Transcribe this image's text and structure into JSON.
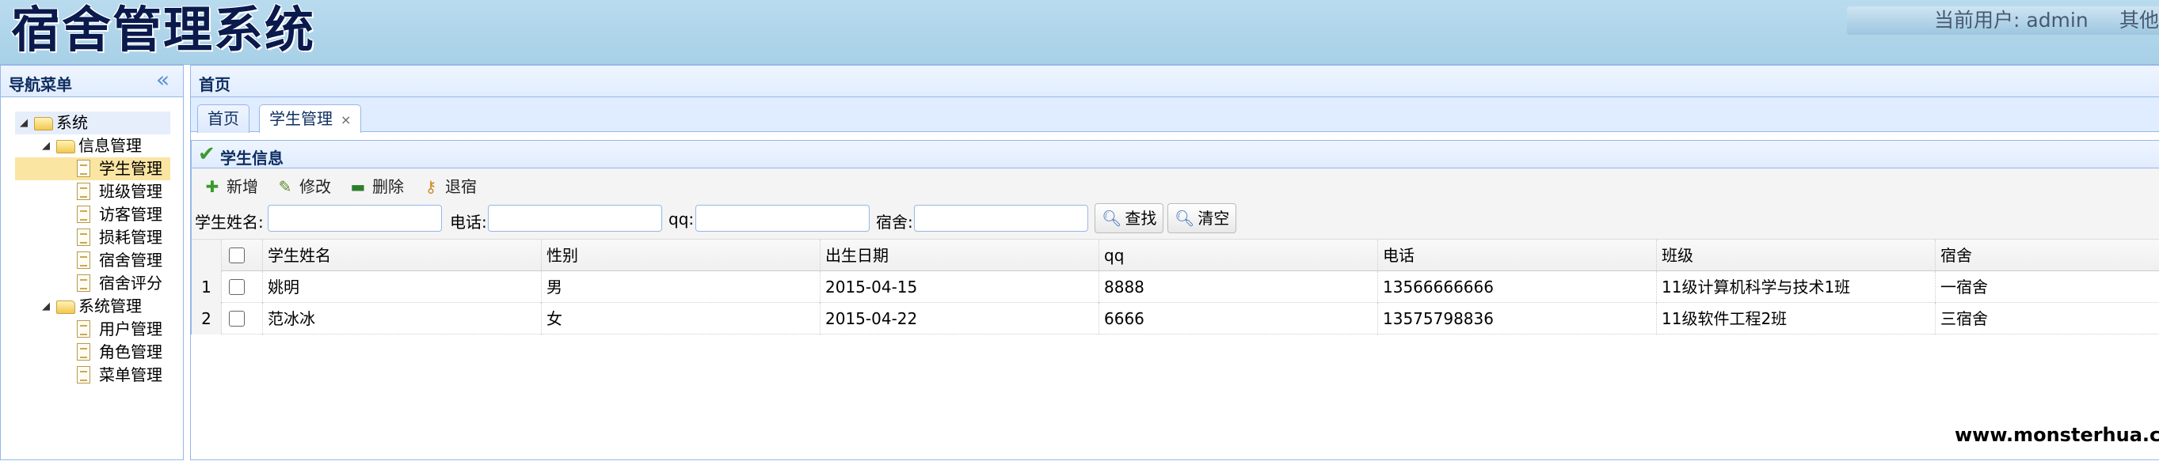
{
  "header": {
    "app_title": "宿舍管理系统",
    "current_user_label": "当前用户: admin",
    "other_label": "其他"
  },
  "nav": {
    "title": "导航菜单",
    "tree": [
      {
        "label": "系统"
      },
      {
        "label": "信息管理"
      },
      {
        "label": "学生管理"
      },
      {
        "label": "班级管理"
      },
      {
        "label": "访客管理"
      },
      {
        "label": "损耗管理"
      },
      {
        "label": "宿舍管理"
      },
      {
        "label": "宿舍评分"
      },
      {
        "label": "系统管理"
      },
      {
        "label": "用户管理"
      },
      {
        "label": "角色管理"
      },
      {
        "label": "菜单管理"
      }
    ]
  },
  "main": {
    "title": "首页",
    "tabs": [
      {
        "label": "首页"
      },
      {
        "label": "学生管理",
        "close": "×"
      }
    ],
    "panel_title": "学生信息",
    "toolbar": {
      "add": "新增",
      "edit": "修改",
      "delete": "删除",
      "checkout": "退宿"
    },
    "search": {
      "name_label": "学生姓名:",
      "name_value": "",
      "phone_label": "电话:",
      "phone_value": "",
      "qq_label": "qq:",
      "qq_value": "",
      "dorm_label": "宿舍:",
      "dorm_value": "",
      "search_button": "查找",
      "clear_button": "清空"
    },
    "grid": {
      "columns": [
        "学生姓名",
        "性别",
        "出生日期",
        "qq",
        "电话",
        "班级",
        "宿舍"
      ],
      "rows": [
        {
          "num": "1",
          "cells": [
            "姚明",
            "男",
            "2015-04-15",
            "8888",
            "13566666666",
            "11级计算机科学与技术1班",
            "一宿舍"
          ]
        },
        {
          "num": "2",
          "cells": [
            "范冰冰",
            "女",
            "2015-04-22",
            "6666",
            "13575798836",
            "11级软件工程2班",
            "三宿舍"
          ]
        }
      ]
    }
  },
  "watermark": "www.monsterhua.com"
}
